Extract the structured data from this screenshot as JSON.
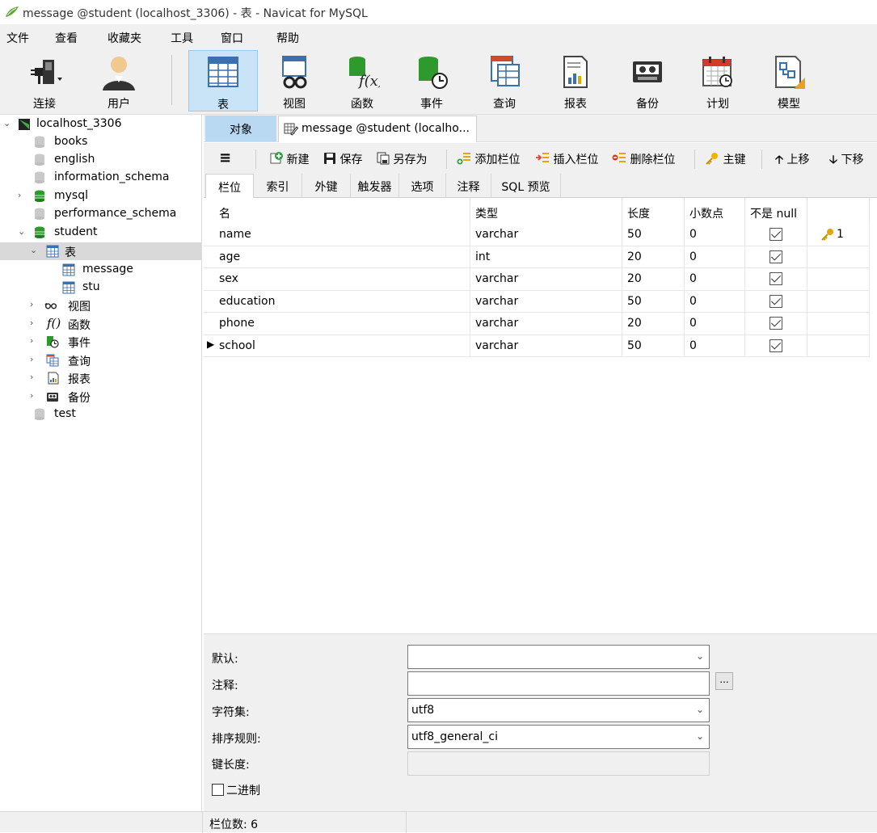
{
  "window": {
    "title": "message @student (localhost_3306) - 表 - Navicat for MySQL"
  },
  "menu": [
    "文件",
    "查看",
    "收藏夹",
    "工具",
    "窗口",
    "帮助"
  ],
  "toolbar": {
    "connect": "连接",
    "user": "用户",
    "table": "表",
    "view": "视图",
    "function": "函数",
    "event": "事件",
    "query": "查询",
    "report": "报表",
    "backup": "备份",
    "schedule": "计划",
    "model": "模型"
  },
  "tree": {
    "connection": "localhost_3306",
    "databases": [
      "books",
      "english",
      "information_schema",
      "mysql",
      "performance_schema",
      "student"
    ],
    "student_children": {
      "tables": "表",
      "views": "视图",
      "functions": "函数",
      "events": "事件",
      "queries": "查询",
      "reports": "报表",
      "backups": "备份"
    },
    "tables": [
      "message",
      "stu"
    ],
    "last_db": "test"
  },
  "tabs": {
    "objects": "对象",
    "editor": "message @student (localho..."
  },
  "subtoolbar": {
    "new": "新建",
    "save": "保存",
    "save_as": "另存为",
    "add_field": "添加栏位",
    "insert_field": "插入栏位",
    "delete_field": "删除栏位",
    "primary_key": "主键",
    "move_up": "上移",
    "move_down": "下移"
  },
  "field_tabs": [
    "栏位",
    "索引",
    "外键",
    "触发器",
    "选项",
    "注释",
    "SQL 预览"
  ],
  "grid": {
    "headers": [
      "名",
      "类型",
      "长度",
      "小数点",
      "不是 null",
      ""
    ],
    "rows": [
      {
        "name": "name",
        "type": "varchar",
        "length": "50",
        "decimals": "0",
        "not_null": true,
        "key": "1"
      },
      {
        "name": "age",
        "type": "int",
        "length": "20",
        "decimals": "0",
        "not_null": true,
        "key": ""
      },
      {
        "name": "sex",
        "type": "varchar",
        "length": "20",
        "decimals": "0",
        "not_null": true,
        "key": ""
      },
      {
        "name": "education",
        "type": "varchar",
        "length": "50",
        "decimals": "0",
        "not_null": true,
        "key": ""
      },
      {
        "name": "phone",
        "type": "varchar",
        "length": "20",
        "decimals": "0",
        "not_null": true,
        "key": ""
      },
      {
        "name": "school",
        "type": "varchar",
        "length": "50",
        "decimals": "0",
        "not_null": true,
        "key": ""
      }
    ]
  },
  "props": {
    "default_label": "默认:",
    "default_value": "",
    "comment_label": "注释:",
    "comment_value": "",
    "comment_btn": "...",
    "charset_label": "字符集:",
    "charset_value": "utf8",
    "collation_label": "排序规则:",
    "collation_value": "utf8_general_ci",
    "keylen_label": "键长度:",
    "keylen_value": "",
    "binary_label": "二进制"
  },
  "status": {
    "field_count": "栏位数: 6"
  },
  "colors": {
    "accent": "#c9e3f7",
    "obj_tab": "#b9d9f2",
    "db_green": "#2e9a2e",
    "key_gold": "#e0a800"
  }
}
